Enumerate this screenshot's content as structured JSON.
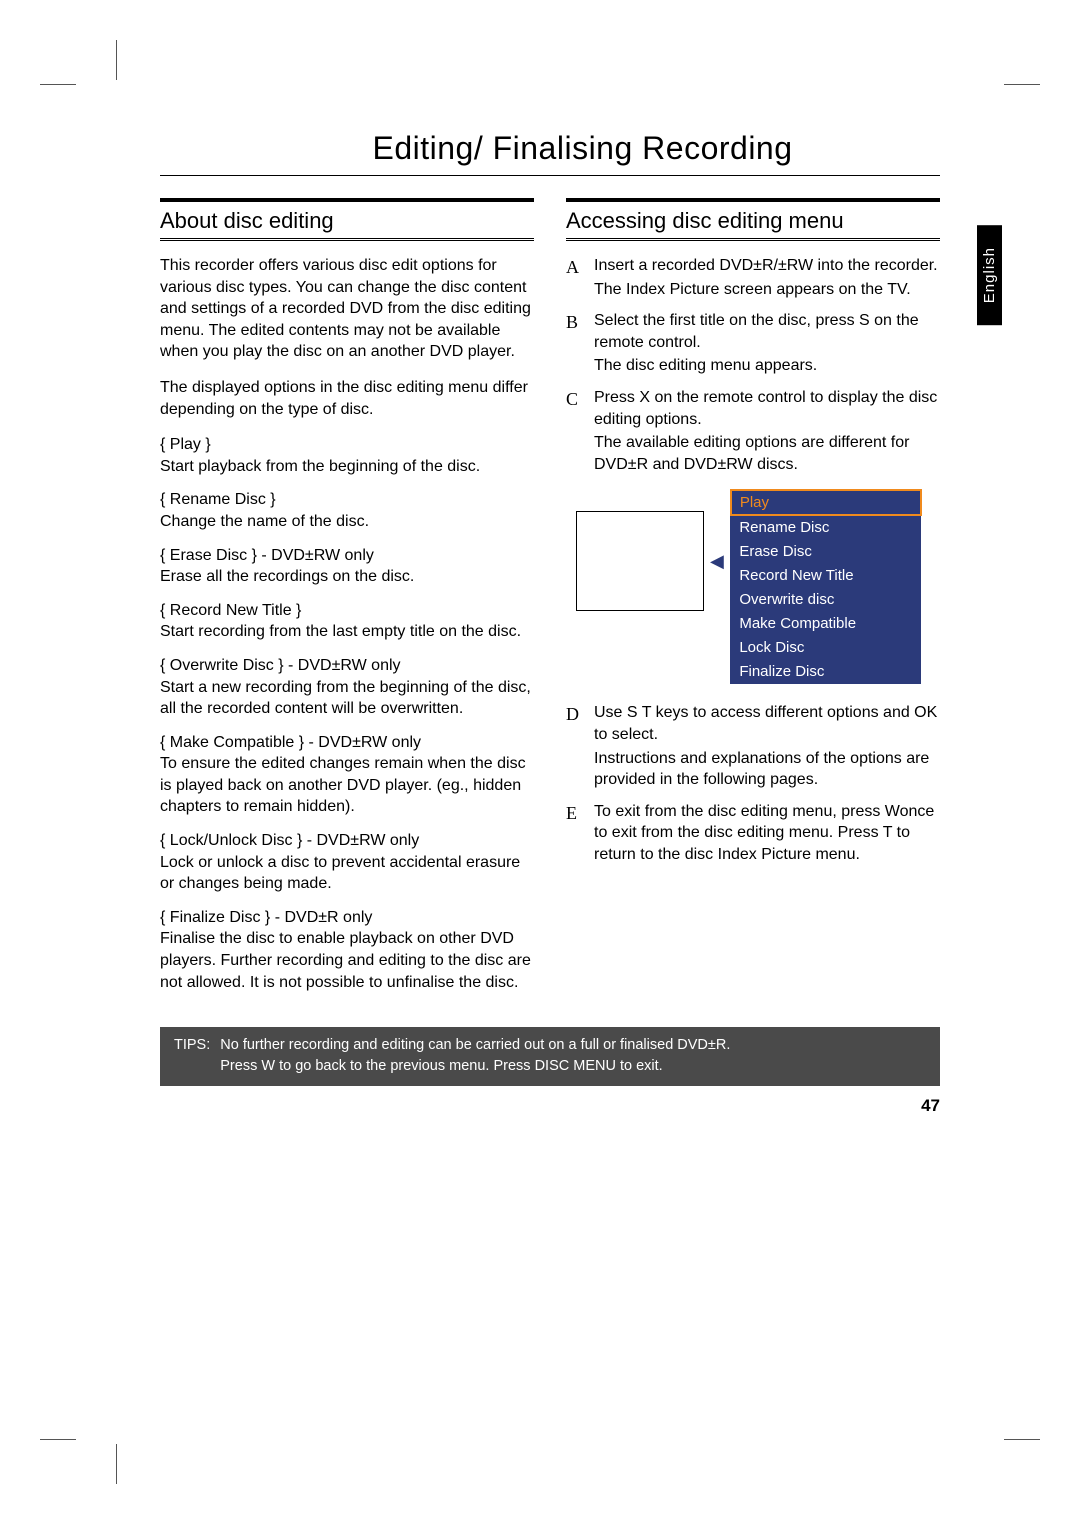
{
  "page": {
    "title": "Editing/ Finalising Recording",
    "language_tab": "English",
    "page_number": "47"
  },
  "left": {
    "heading": "About disc editing",
    "intro1": "This recorder offers various disc edit options for various disc types. You can change the disc content and settings of a recorded DVD from the disc editing menu. The edited contents may not be available when you play the disc on an another DVD player.",
    "intro2": "The displayed options in the disc editing menu differ depending on the type of disc.",
    "terms": [
      {
        "title": "{ Play }",
        "desc": "Start playback from the beginning of the disc."
      },
      {
        "title": "{ Rename Disc }",
        "desc": "Change the name of the disc."
      },
      {
        "title": "{ Erase Disc } - DVD±RW only",
        "desc": "Erase all the recordings on the disc."
      },
      {
        "title": "{ Record New Title  }",
        "desc": "Start recording from the last empty title on the disc."
      },
      {
        "title": "{ Overwrite Disc  } - DVD±RW only",
        "desc": "Start a new recording from the beginning of the disc, all the recorded content will be overwritten."
      },
      {
        "title": "{ Make Compatible  } - DVD±RW only",
        "desc": "To ensure the edited changes remain when the disc is played back on another DVD player. (eg., hidden chapters to remain hidden)."
      },
      {
        "title": "{ Lock/Unlock Disc  } - DVD±RW only",
        "desc": "Lock or unlock a disc to prevent accidental erasure or changes being made."
      },
      {
        "title": "{ Finalize Disc } - DVD±R only",
        "desc": "Finalise the disc to enable playback on other DVD players. Further recording and editing to the disc are not allowed. It is not possible to unfinalise the disc."
      }
    ]
  },
  "right": {
    "heading": "Accessing disc editing menu",
    "steps": [
      {
        "m": "A",
        "text": "Insert a recorded DVD±R/±RW into the recorder.",
        "sub": "The Index Picture screen appears on the TV."
      },
      {
        "m": "B",
        "text": "Select the first title on the disc, press  S on the remote control.",
        "sub": "The disc editing menu appears."
      },
      {
        "m": "C",
        "text": "Press  X on the remote control to display the disc editing options.",
        "sub": "The available editing options are different for DVD±R and DVD±RW discs."
      }
    ],
    "menu_items": [
      "Play",
      "Rename Disc",
      "Erase Disc",
      "Record New Title",
      "Overwrite disc",
      "Make Compatible",
      "Lock Disc",
      "Finalize Disc"
    ],
    "steps_after": [
      {
        "m": "D",
        "text": "Use  S T  keys to access different options and OK  to select.",
        "sub": "Instructions and explanations of the options are provided in the following pages."
      },
      {
        "m": "E",
        "text": "To exit from the disc editing menu, press Wonce to exit from the disc editing menu.  Press  T  to return to the disc Index Picture menu.",
        "sub": ""
      }
    ]
  },
  "tips": {
    "label": "TIPS:",
    "line1": "No further recording and editing can be carried out on a full or finalised DVD±R.",
    "line2": "Press W to go back to the previous menu. Press DISC MENU  to exit."
  }
}
